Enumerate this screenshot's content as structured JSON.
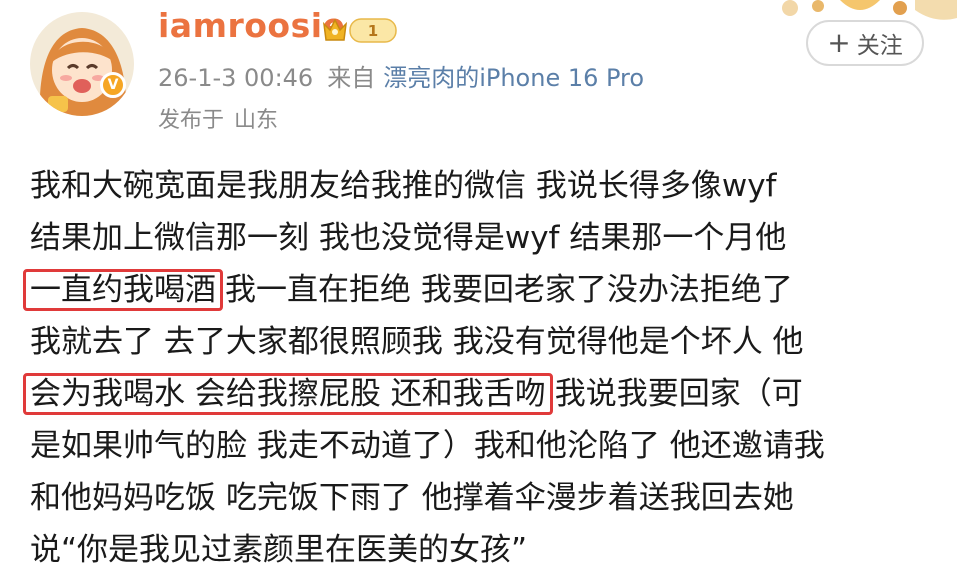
{
  "user": {
    "name": "iamroosie",
    "vip_level": "1",
    "verified_mark": "V"
  },
  "meta": {
    "timestamp": "26-1-3 00:46",
    "source_prefix": "来自",
    "device": "漂亮肉的iPhone 16 Pro",
    "location_label": "发布于",
    "location": "山东"
  },
  "follow_button": {
    "icon": "+",
    "label": "关注"
  },
  "post": {
    "line1": "我和大碗宽面是我朋友给我推的微信 我说长得多像wyf",
    "line2": "结果加上微信那一刻 我也没觉得是wyf 结果那一个月他",
    "line3_highlight": "一直约我喝酒",
    "line3_rest": "我一直在拒绝 我要回老家了没办法拒绝了",
    "line4": "我就去了 去了大家都很照顾我 我没有觉得他是个坏人 他",
    "line5_highlight": "会为我喝水 会给我擦屁股 还和我舌吻",
    "line5_rest": "我说我要回家（可",
    "line6": "是如果帅气的脸 我走不动道了）我和他沦陷了 他还邀请我",
    "line7": "和他妈妈吃饭 吃完饭下雨了 他撑着伞漫步着送我回去她",
    "line8": "说“你是我见过素颜里在医美的女孩”"
  },
  "colors": {
    "username": "#eb7340",
    "device_link": "#5b7fa8",
    "highlight_box": "#e03a3a",
    "meta_text": "#8a8a8a"
  },
  "icons": {
    "avatar": "avatar-illustration",
    "verified": "verified-badge-icon",
    "vip": "crown-vip-icon",
    "follow": "plus-icon"
  }
}
